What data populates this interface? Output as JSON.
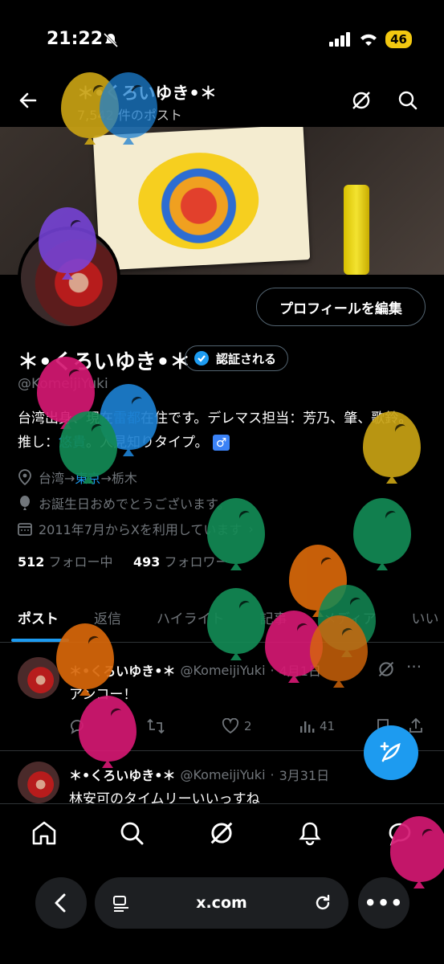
{
  "status_bar": {
    "time": "21:22",
    "battery": "46"
  },
  "header": {
    "title": "＊•くろいゆき•＊",
    "post_count": "7,542 件のポスト"
  },
  "profile": {
    "edit_label": "プロフィールを編集",
    "name": "＊•くろいゆき•＊",
    "verify_label": "認証される",
    "handle": "@KomeijiYuki",
    "bio_part1": "台湾出身、現在",
    "bio_link1": "雷都",
    "bio_part2": "在住です。デレマス担当：芳乃、肇、歌鈴。 推し：",
    "bio_link2": "悠貴",
    "bio_part3": "。人見知りタイプ。",
    "bio_badge": "♂",
    "location_part1": "台湾→",
    "location_link": "東京",
    "location_part2": "→栃木",
    "birthday": "お誕生日おめでとうございます。",
    "joined": "2011年7月からXを利用しています",
    "following_count": "512",
    "following_label": "フォロー中",
    "followers_count": "493",
    "followers_label": "フォロワー"
  },
  "tabs": [
    "ポスト",
    "返信",
    "ハイライト",
    "記事",
    "メディア",
    "いい"
  ],
  "posts": [
    {
      "name": "＊•くろいゆき•＊",
      "handle": "@KomeijiYuki",
      "date": "4月1日",
      "text": "アンコー！",
      "likes": "2",
      "views": "41"
    },
    {
      "name": "＊•くろいゆき•＊",
      "handle": "@KomeijiYuki",
      "date": "3月31日",
      "text": "林安可のタイムリーいいっすね"
    }
  ],
  "browser": {
    "url": "x.com"
  },
  "colors": {
    "accent": "#1d9bf0",
    "background": "#000000",
    "muted": "#71767b"
  }
}
